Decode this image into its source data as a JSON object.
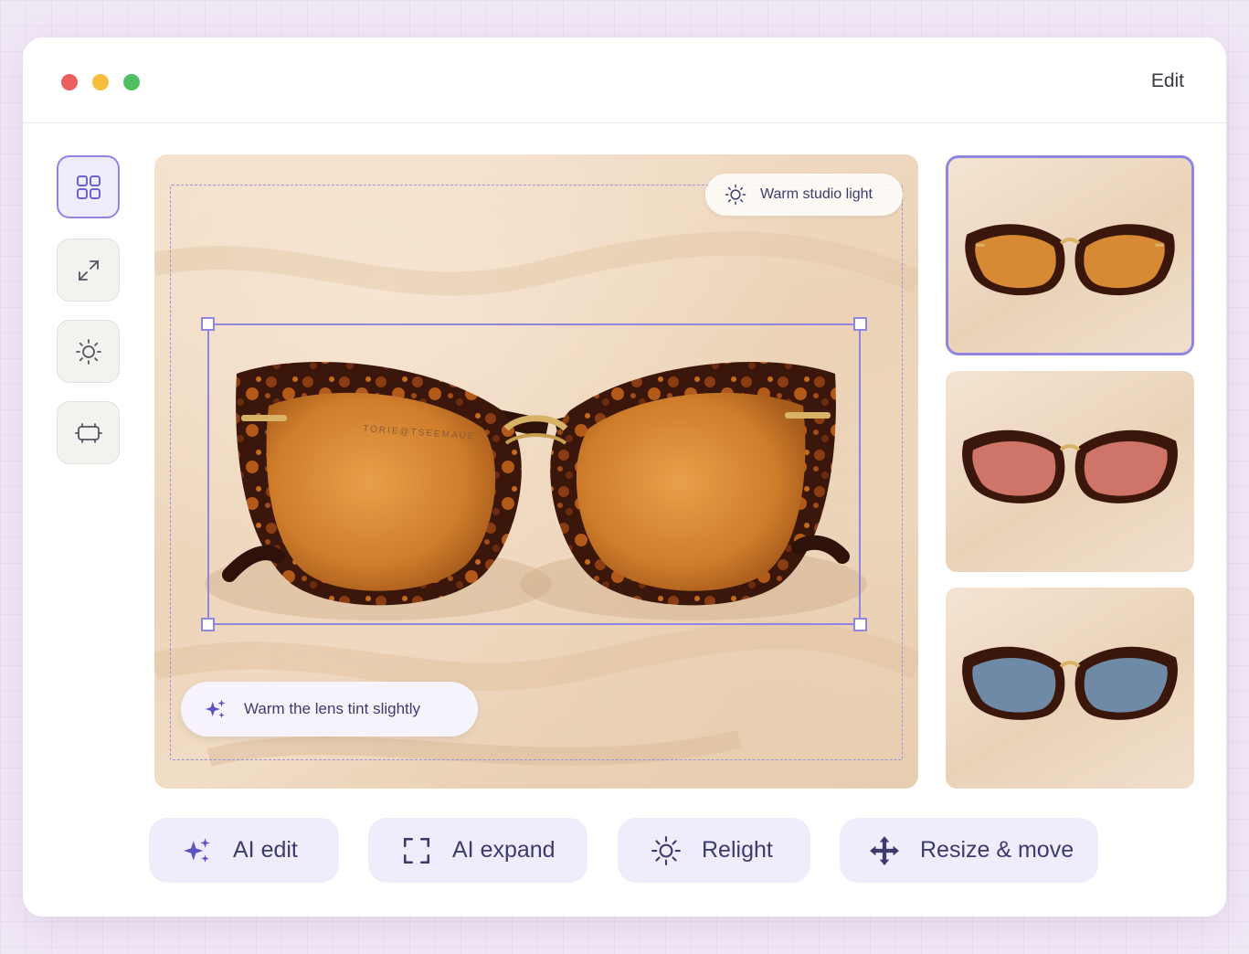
{
  "window": {
    "title": "Edit",
    "traffic_lights": [
      "close",
      "minimize",
      "maximize"
    ],
    "colors": {
      "close": "#ec5f5f",
      "minimize": "#f5bd3c",
      "maximize": "#4fbf61"
    }
  },
  "sidebar": {
    "tools": [
      {
        "icon": "grid-icon",
        "active": true
      },
      {
        "icon": "expand-arrows-icon",
        "active": false
      },
      {
        "icon": "sun-icon",
        "active": false
      },
      {
        "icon": "frame-icon",
        "active": false
      }
    ]
  },
  "canvas": {
    "light_chip": "Warm studio light",
    "prompt_chip": "Warm the lens tint slightly",
    "frame_text": "TORIE@TSEEMAUE"
  },
  "variants": [
    {
      "lens_color": "#d78a33",
      "selected": true
    },
    {
      "lens_color": "#cf7468",
      "selected": false
    },
    {
      "lens_color": "#6f8aa6",
      "selected": false
    }
  ],
  "actions": [
    {
      "label": "AI edit",
      "icon": "sparkles-icon"
    },
    {
      "label": "AI expand",
      "icon": "expand-corners-icon"
    },
    {
      "label": "Relight",
      "icon": "sun-icon"
    },
    {
      "label": "Resize & move",
      "icon": "move-arrows-icon"
    }
  ],
  "colors": {
    "accent": "#8f86e0",
    "text": "#3d3b6e",
    "chip_bg": "#efedfb"
  }
}
